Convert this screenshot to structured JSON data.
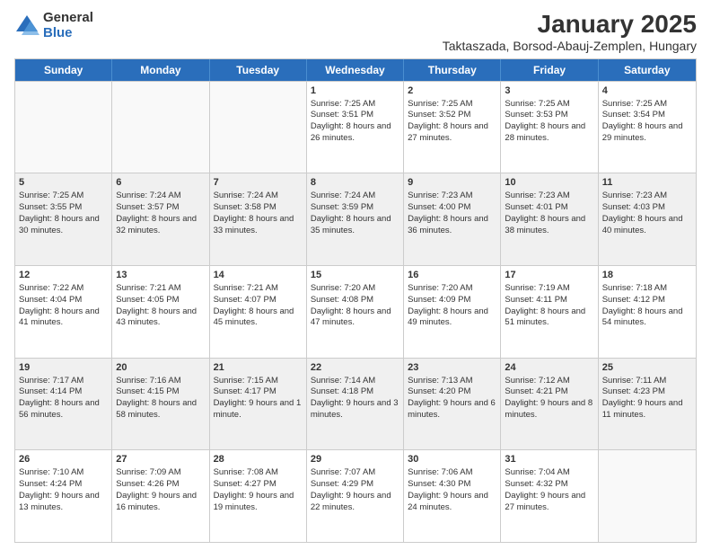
{
  "logo": {
    "general": "General",
    "blue": "Blue"
  },
  "title": "January 2025",
  "subtitle": "Taktaszada, Borsod-Abauj-Zemplen, Hungary",
  "days_of_week": [
    "Sunday",
    "Monday",
    "Tuesday",
    "Wednesday",
    "Thursday",
    "Friday",
    "Saturday"
  ],
  "weeks": [
    [
      {
        "day": "",
        "empty": true
      },
      {
        "day": "",
        "empty": true
      },
      {
        "day": "",
        "empty": true
      },
      {
        "day": "1",
        "sunrise": "7:25 AM",
        "sunset": "3:51 PM",
        "daylight": "8 hours and 26 minutes."
      },
      {
        "day": "2",
        "sunrise": "7:25 AM",
        "sunset": "3:52 PM",
        "daylight": "8 hours and 27 minutes."
      },
      {
        "day": "3",
        "sunrise": "7:25 AM",
        "sunset": "3:53 PM",
        "daylight": "8 hours and 28 minutes."
      },
      {
        "day": "4",
        "sunrise": "7:25 AM",
        "sunset": "3:54 PM",
        "daylight": "8 hours and 29 minutes."
      }
    ],
    [
      {
        "day": "5",
        "sunrise": "7:25 AM",
        "sunset": "3:55 PM",
        "daylight": "8 hours and 30 minutes."
      },
      {
        "day": "6",
        "sunrise": "7:24 AM",
        "sunset": "3:57 PM",
        "daylight": "8 hours and 32 minutes."
      },
      {
        "day": "7",
        "sunrise": "7:24 AM",
        "sunset": "3:58 PM",
        "daylight": "8 hours and 33 minutes."
      },
      {
        "day": "8",
        "sunrise": "7:24 AM",
        "sunset": "3:59 PM",
        "daylight": "8 hours and 35 minutes."
      },
      {
        "day": "9",
        "sunrise": "7:23 AM",
        "sunset": "4:00 PM",
        "daylight": "8 hours and 36 minutes."
      },
      {
        "day": "10",
        "sunrise": "7:23 AM",
        "sunset": "4:01 PM",
        "daylight": "8 hours and 38 minutes."
      },
      {
        "day": "11",
        "sunrise": "7:23 AM",
        "sunset": "4:03 PM",
        "daylight": "8 hours and 40 minutes."
      }
    ],
    [
      {
        "day": "12",
        "sunrise": "7:22 AM",
        "sunset": "4:04 PM",
        "daylight": "8 hours and 41 minutes."
      },
      {
        "day": "13",
        "sunrise": "7:21 AM",
        "sunset": "4:05 PM",
        "daylight": "8 hours and 43 minutes."
      },
      {
        "day": "14",
        "sunrise": "7:21 AM",
        "sunset": "4:07 PM",
        "daylight": "8 hours and 45 minutes."
      },
      {
        "day": "15",
        "sunrise": "7:20 AM",
        "sunset": "4:08 PM",
        "daylight": "8 hours and 47 minutes."
      },
      {
        "day": "16",
        "sunrise": "7:20 AM",
        "sunset": "4:09 PM",
        "daylight": "8 hours and 49 minutes."
      },
      {
        "day": "17",
        "sunrise": "7:19 AM",
        "sunset": "4:11 PM",
        "daylight": "8 hours and 51 minutes."
      },
      {
        "day": "18",
        "sunrise": "7:18 AM",
        "sunset": "4:12 PM",
        "daylight": "8 hours and 54 minutes."
      }
    ],
    [
      {
        "day": "19",
        "sunrise": "7:17 AM",
        "sunset": "4:14 PM",
        "daylight": "8 hours and 56 minutes."
      },
      {
        "day": "20",
        "sunrise": "7:16 AM",
        "sunset": "4:15 PM",
        "daylight": "8 hours and 58 minutes."
      },
      {
        "day": "21",
        "sunrise": "7:15 AM",
        "sunset": "4:17 PM",
        "daylight": "9 hours and 1 minute."
      },
      {
        "day": "22",
        "sunrise": "7:14 AM",
        "sunset": "4:18 PM",
        "daylight": "9 hours and 3 minutes."
      },
      {
        "day": "23",
        "sunrise": "7:13 AM",
        "sunset": "4:20 PM",
        "daylight": "9 hours and 6 minutes."
      },
      {
        "day": "24",
        "sunrise": "7:12 AM",
        "sunset": "4:21 PM",
        "daylight": "9 hours and 8 minutes."
      },
      {
        "day": "25",
        "sunrise": "7:11 AM",
        "sunset": "4:23 PM",
        "daylight": "9 hours and 11 minutes."
      }
    ],
    [
      {
        "day": "26",
        "sunrise": "7:10 AM",
        "sunset": "4:24 PM",
        "daylight": "9 hours and 13 minutes."
      },
      {
        "day": "27",
        "sunrise": "7:09 AM",
        "sunset": "4:26 PM",
        "daylight": "9 hours and 16 minutes."
      },
      {
        "day": "28",
        "sunrise": "7:08 AM",
        "sunset": "4:27 PM",
        "daylight": "9 hours and 19 minutes."
      },
      {
        "day": "29",
        "sunrise": "7:07 AM",
        "sunset": "4:29 PM",
        "daylight": "9 hours and 22 minutes."
      },
      {
        "day": "30",
        "sunrise": "7:06 AM",
        "sunset": "4:30 PM",
        "daylight": "9 hours and 24 minutes."
      },
      {
        "day": "31",
        "sunrise": "7:04 AM",
        "sunset": "4:32 PM",
        "daylight": "9 hours and 27 minutes."
      },
      {
        "day": "",
        "empty": true
      }
    ]
  ]
}
